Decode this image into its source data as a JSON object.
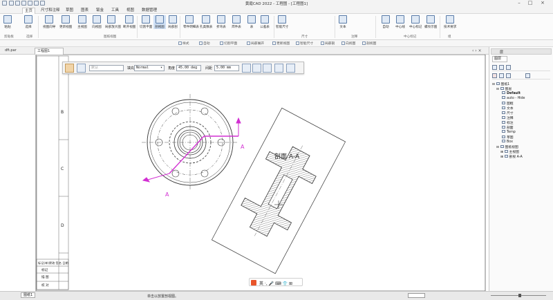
{
  "window": {
    "title": "黄霞CAD 2022 - 工程图 - [工程图1]"
  },
  "menu": {
    "tabs": [
      "主页",
      "尺寸和注释",
      "草图",
      "图表",
      "钣金",
      "工具",
      "视图",
      "数据管理"
    ],
    "active_index": 0
  },
  "ribbon": {
    "buttons": [
      "粘贴",
      "选择",
      "视图向导",
      "更新视图",
      "主视图",
      "向视图",
      "局部放大图",
      "断开视图",
      "切割平面",
      "剖视图",
      "局部剖",
      "零件明细表",
      "孔类数表",
      "折弯表",
      "焊件表",
      "表",
      "公差表",
      "智能尺寸",
      "文本",
      "自动",
      "中心线",
      "中心标记",
      "螺纹示图",
      "技术要求"
    ],
    "groups": [
      "剪贴板",
      "选择",
      "图纸视图",
      "尺寸",
      "注释",
      "中心标记",
      "组"
    ]
  },
  "subtoolbar": {
    "items": [
      "样式",
      "自动",
      "切割平面",
      "局部展开",
      "更新视图",
      "智能尺寸",
      "局部剖",
      "向视图",
      "剖视图"
    ]
  },
  "doc_tabs": [
    {
      "label": "dft.par",
      "active": false
    },
    {
      "label": "工程图1",
      "active": true
    }
  ],
  "options_bar": {
    "style_label": "默认",
    "fill_label": "填充",
    "fill_value": "Normal",
    "angle_label": "角度",
    "angle_value": "45.00 deg",
    "spacing_label": "间距",
    "spacing_value": "5.00 mm"
  },
  "drawing": {
    "zone_labels": [
      "B",
      "C",
      "D"
    ],
    "section_title": "剖面 A-A",
    "cut_label_1": "A",
    "cut_label_2": "A",
    "title_block": [
      "标记(单)更改 签名 日期",
      "标记",
      "描 图",
      "校 对"
    ]
  },
  "right_panel": {
    "header": "层",
    "tab_label": "图层",
    "root": "图纸1",
    "nodes": [
      "图层",
      "Default",
      "auto - Hide",
      "图框",
      "文本",
      "尺寸",
      "注释",
      "标注",
      "剖面",
      "Temp",
      "草图",
      "Box",
      "图纸视图",
      "主视图",
      "剖视 A-A"
    ]
  },
  "statusbar": {
    "message": "单击以放置剖视图。",
    "sheet_tab": "图纸1",
    "zoom_label": "缩放"
  },
  "colors": {
    "accent": "#2b64c4",
    "annotation": "#d22fd2",
    "ribbon_bg": "#fbfbfb"
  }
}
